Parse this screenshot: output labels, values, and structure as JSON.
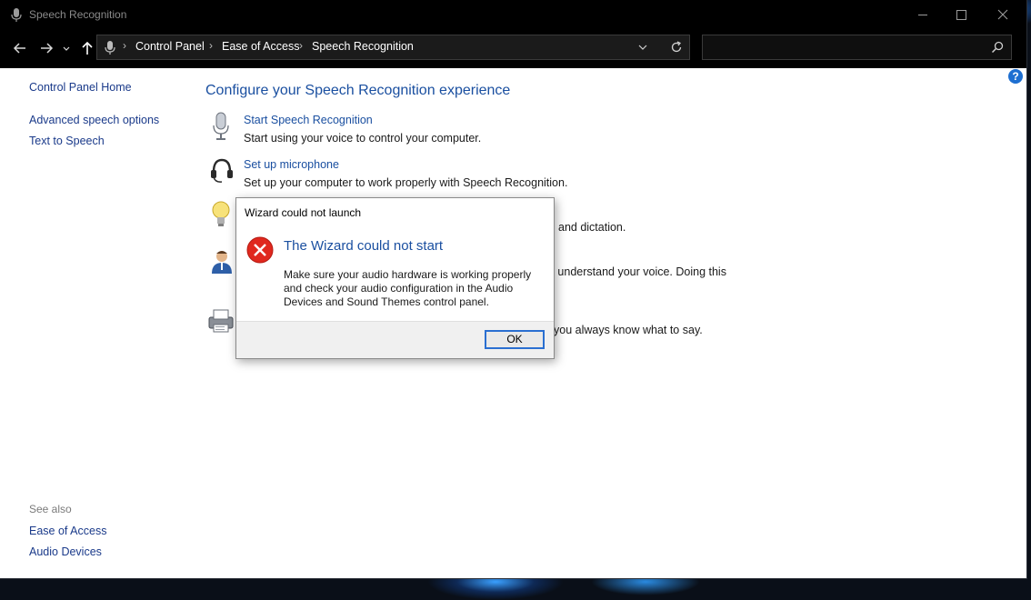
{
  "window": {
    "title": "Speech Recognition"
  },
  "address_bar": {
    "crumbs": [
      "Control Panel",
      "Ease of Access",
      "Speech Recognition"
    ],
    "search_placeholder": ""
  },
  "left_nav": {
    "home": "Control Panel Home",
    "links": [
      "Advanced speech options",
      "Text to Speech"
    ],
    "see_also_title": "See also",
    "see_also": [
      "Ease of Access",
      "Audio Devices"
    ]
  },
  "main": {
    "heading": "Configure your Speech Recognition experience",
    "tasks": [
      {
        "link": "Start Speech Recognition",
        "desc": "Start using your voice to control your computer.",
        "icon": "microphone-icon"
      },
      {
        "link": "Set up microphone",
        "desc": "Set up your computer to work properly with Speech Recognition.",
        "icon": "headset-icon"
      },
      {
        "link": "",
        "desc": "and dictation.",
        "icon": "lightbulb-icon"
      },
      {
        "link": "",
        "desc": "o understand your voice.  Doing this",
        "icon": "user-icon"
      },
      {
        "link": "",
        "desc": "you always know what to say.",
        "icon": "printer-icon"
      }
    ]
  },
  "dialog": {
    "title": "Wizard could not launch",
    "heading": "The Wizard could not start",
    "message": "Make sure your audio hardware is working properly and check your audio configuration in the Audio Devices and Sound Themes control panel.",
    "ok": "OK"
  },
  "colors": {
    "link": "#1a4fa0",
    "error": "#e0281e",
    "titlebar": "#000000",
    "focus": "#2a6fd1"
  }
}
